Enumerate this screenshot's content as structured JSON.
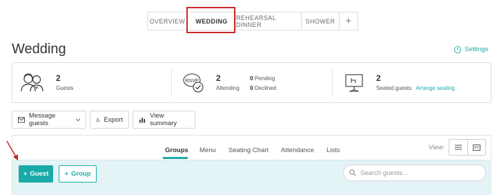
{
  "top_tabs": {
    "overview": "OVERVIEW",
    "wedding": "WEDDING",
    "rehearsal": "REHEARSAL DINNER",
    "shower": "SHOWER",
    "add": "+"
  },
  "header": {
    "title": "Wedding",
    "settings_label": "Settings"
  },
  "stats": {
    "guests": {
      "value": "2",
      "label": "Guests"
    },
    "attending": {
      "value": "2",
      "label": "Attending",
      "pending_count": "0",
      "pending_label": "Pending",
      "declined_count": "0",
      "declined_label": "Declined"
    },
    "seated": {
      "value": "2",
      "label": "Seated guests",
      "link": "Arrange seating"
    },
    "rsvp_icon_text": "RSVP"
  },
  "toolbar": {
    "message_guests": "Message guests",
    "export": "Export",
    "view_summary": "View summary"
  },
  "subtabs": [
    "Groups",
    "Menu",
    "Seating Chart",
    "Attendance",
    "Lists"
  ],
  "view": {
    "label": "View:"
  },
  "actions": {
    "guest_button": "Guest",
    "group_button": "Group",
    "search_placeholder": "Search guests..."
  },
  "colors": {
    "accent": "#1aaba8",
    "highlight": "#c8262b",
    "actionbar_bg": "#e4f3f6"
  }
}
